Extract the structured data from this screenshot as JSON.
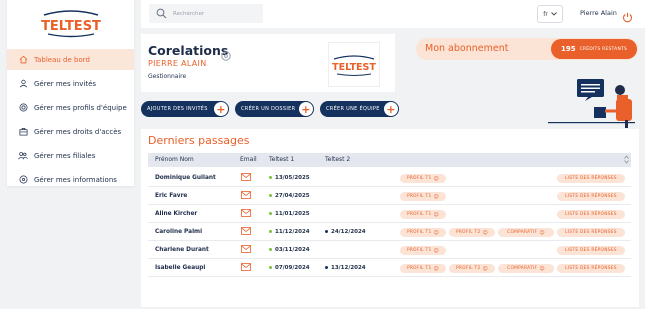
{
  "brand": {
    "logo_text": "TELTEST"
  },
  "sidebar": {
    "items": [
      {
        "label": "Tableau de bord",
        "icon": "home-icon",
        "active": true
      },
      {
        "label": "Gérer mes invités",
        "icon": "user-icon",
        "active": false
      },
      {
        "label": "Gérer mes profils d'équipe",
        "icon": "target-icon",
        "active": false
      },
      {
        "label": "Gérer mes droits d'accès",
        "icon": "briefcase-icon",
        "active": false
      },
      {
        "label": "Gérer mes filiales",
        "icon": "users-icon",
        "active": false
      },
      {
        "label": "Gérer mes informations",
        "icon": "info-icon",
        "active": false
      }
    ]
  },
  "topbar": {
    "search_placeholder": "Rechercher",
    "lang": "fr",
    "user_name": "Pierre Alain"
  },
  "header": {
    "org_name": "Corelations",
    "user_name": "PIERRE ALAIN",
    "role": "Gestionnaire"
  },
  "subscription": {
    "label": "Mon abonnement",
    "credits": "195",
    "credits_label": "CRÉDITS RESTANTS"
  },
  "actions": {
    "add_guests": "AJOUTER DES INVITÉS",
    "create_folder": "CRÉER UN DOSSIER",
    "create_team": "CRÉER UNE ÉQUIPE"
  },
  "passages": {
    "title": "Derniers passages",
    "columns": {
      "name": "Prénom Nom",
      "email": "Email",
      "t1": "Teltest 1",
      "t2": "Teltest 2"
    },
    "reps_label": "LISTE DES RÉPONSES",
    "rows": [
      {
        "name": "Dominique Guilant",
        "t1": "13/05/2025",
        "t2": "",
        "pills": [
          "PROFIL T1"
        ]
      },
      {
        "name": "Eric Favre",
        "t1": "27/04/2025",
        "t2": "",
        "pills": [
          "PROFIL T1"
        ]
      },
      {
        "name": "Aline Kircher",
        "t1": "11/01/2025",
        "t2": "",
        "pills": [
          "PROFIL T1"
        ]
      },
      {
        "name": "Caroline Palmi",
        "t1": "11/12/2024",
        "t2": "24/12/2024",
        "pills": [
          "PROFIL T1",
          "PROFIL T2",
          "COMPARATIF"
        ]
      },
      {
        "name": "Charlene Durant",
        "t1": "03/11/2024",
        "t2": "",
        "pills": [
          "PROFIL T1"
        ]
      },
      {
        "name": "Isabelle Geaupi",
        "t1": "07/09/2024",
        "t2": "13/12/2024",
        "pills": [
          "PROFIL T1",
          "PROFIL T2",
          "COMPARATIF"
        ]
      }
    ]
  },
  "colors": {
    "accent": "#e9602a",
    "navy": "#15325f",
    "accent_light": "#fbe3d6",
    "green": "#7bbf3a"
  }
}
